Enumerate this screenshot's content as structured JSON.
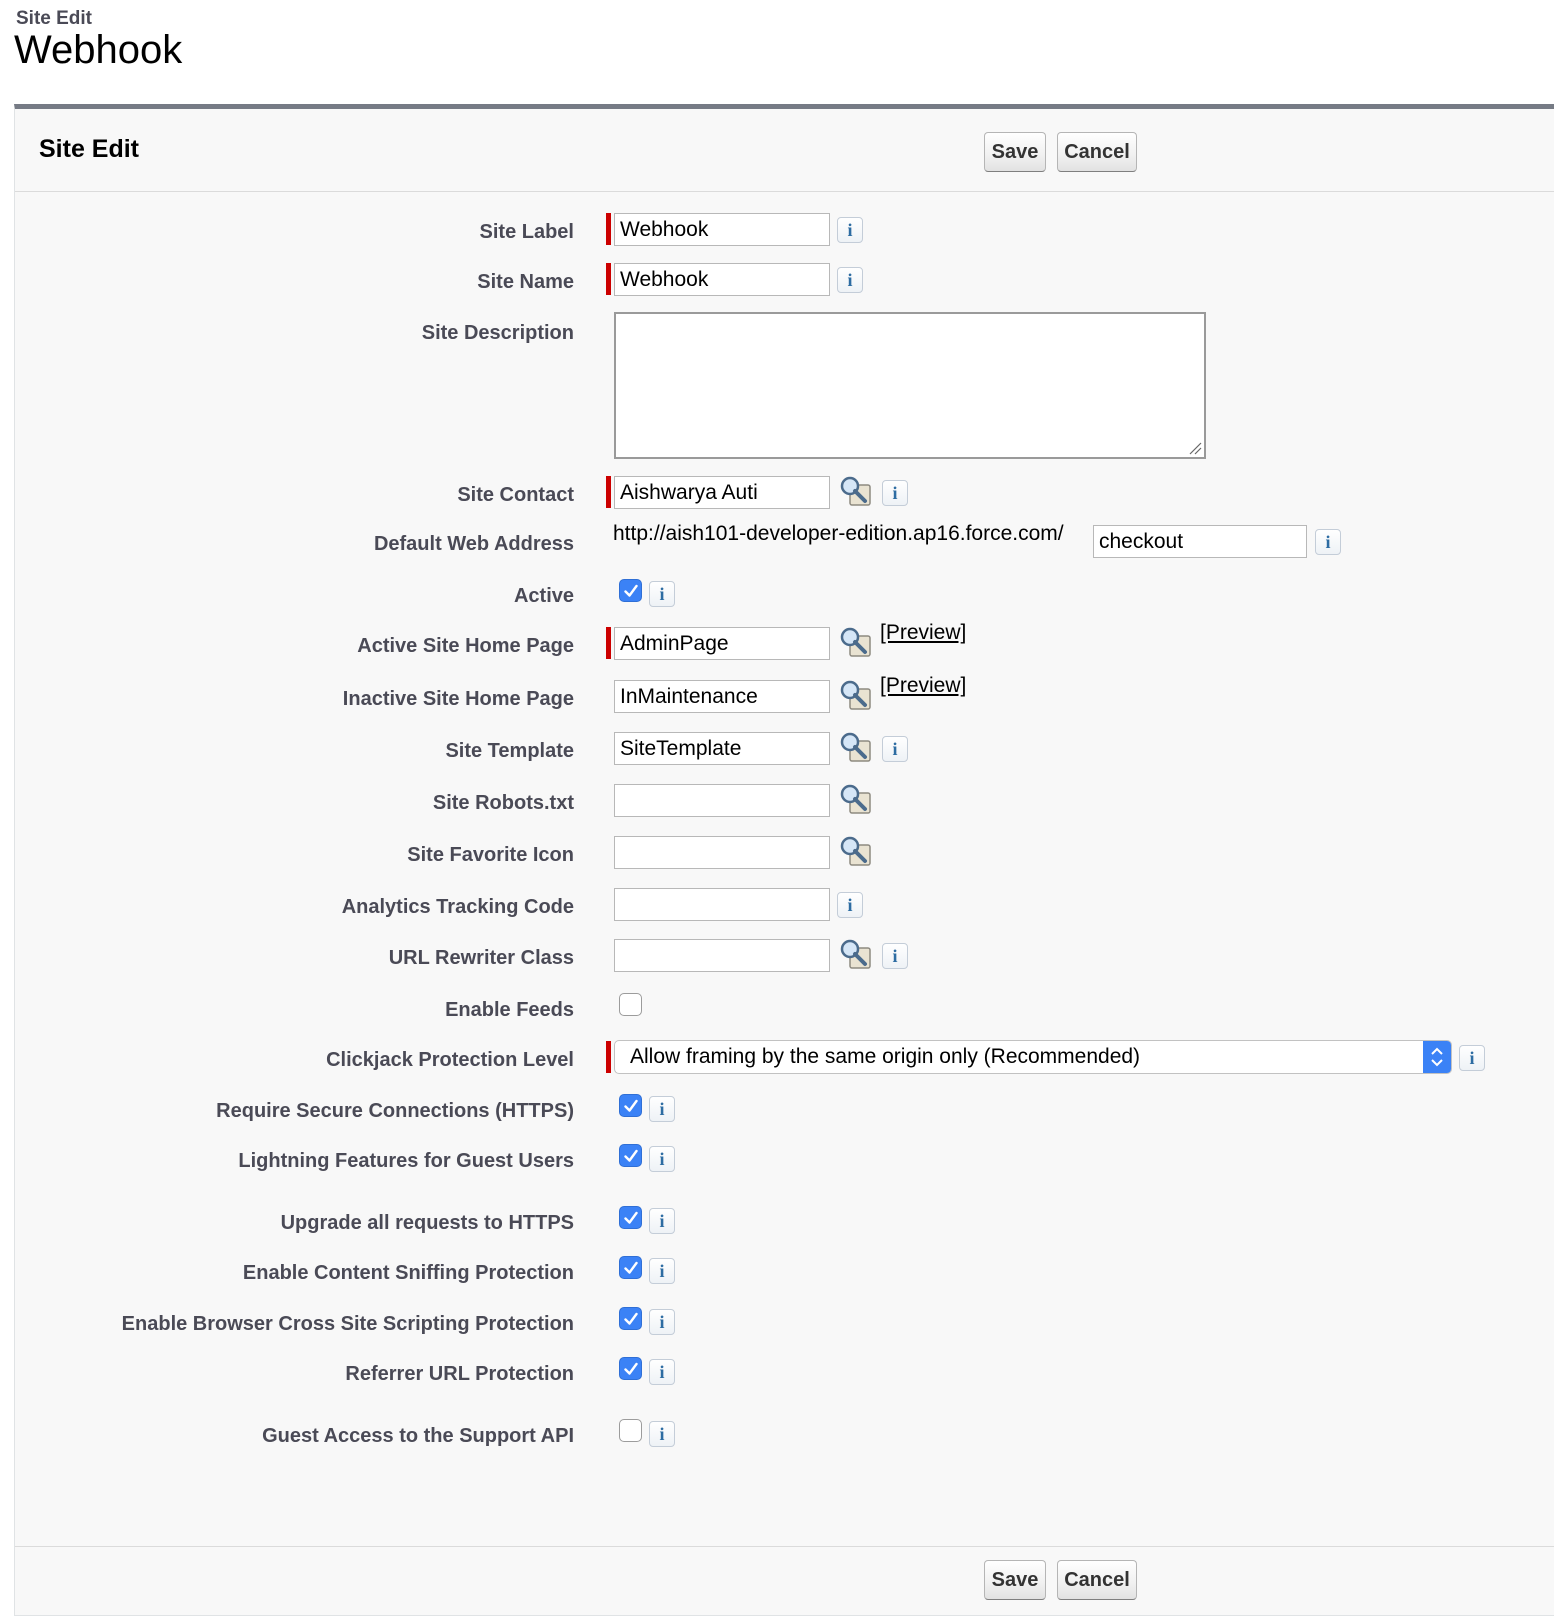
{
  "page": {
    "pre_title": "Site Edit",
    "title": "Webhook"
  },
  "block": {
    "title": "Site Edit",
    "save_label": "Save",
    "cancel_label": "Cancel"
  },
  "fields": {
    "site_label": {
      "label": "Site Label",
      "value": "Webhook"
    },
    "site_name": {
      "label": "Site Name",
      "value": "Webhook"
    },
    "site_description": {
      "label": "Site Description",
      "value": ""
    },
    "site_contact": {
      "label": "Site Contact",
      "value": "Aishwarya Auti"
    },
    "default_web_address": {
      "label": "Default Web Address",
      "prefix": "http://aish101-developer-edition.ap16.force.com/",
      "value": "checkout"
    },
    "active": {
      "label": "Active",
      "checked": true
    },
    "active_home": {
      "label": "Active Site Home Page",
      "value": "AdminPage",
      "preview": "[Preview]"
    },
    "inactive_home": {
      "label": "Inactive Site Home Page",
      "value": "InMaintenance",
      "preview": "[Preview]"
    },
    "site_template": {
      "label": "Site Template",
      "value": "SiteTemplate"
    },
    "robots": {
      "label": "Site Robots.txt",
      "value": ""
    },
    "favicon": {
      "label": "Site Favorite Icon",
      "value": ""
    },
    "analytics": {
      "label": "Analytics Tracking Code",
      "value": ""
    },
    "url_rewriter": {
      "label": "URL Rewriter Class",
      "value": ""
    },
    "enable_feeds": {
      "label": "Enable Feeds",
      "checked": false
    },
    "clickjack": {
      "label": "Clickjack Protection Level",
      "value": "Allow framing by the same origin only (Recommended)"
    },
    "require_https": {
      "label": "Require Secure Connections (HTTPS)",
      "checked": true
    },
    "lightning_guest": {
      "label": "Lightning Features for Guest Users",
      "checked": true
    },
    "upgrade_https": {
      "label": "Upgrade all requests to HTTPS",
      "checked": true
    },
    "content_sniffing": {
      "label": "Enable Content Sniffing Protection",
      "checked": true
    },
    "xss_protection": {
      "label": "Enable Browser Cross Site Scripting Protection",
      "checked": true
    },
    "referrer": {
      "label": "Referrer URL Protection",
      "checked": true
    },
    "guest_support_api": {
      "label": "Guest Access to the Support API",
      "checked": false
    }
  },
  "icons": {
    "info": "info-icon",
    "lookup": "lookup-magnifier-icon",
    "required": "required-marker"
  },
  "colors": {
    "required": "#cc0000",
    "checkbox": "#3b82f6",
    "header_border": "#767b85"
  }
}
